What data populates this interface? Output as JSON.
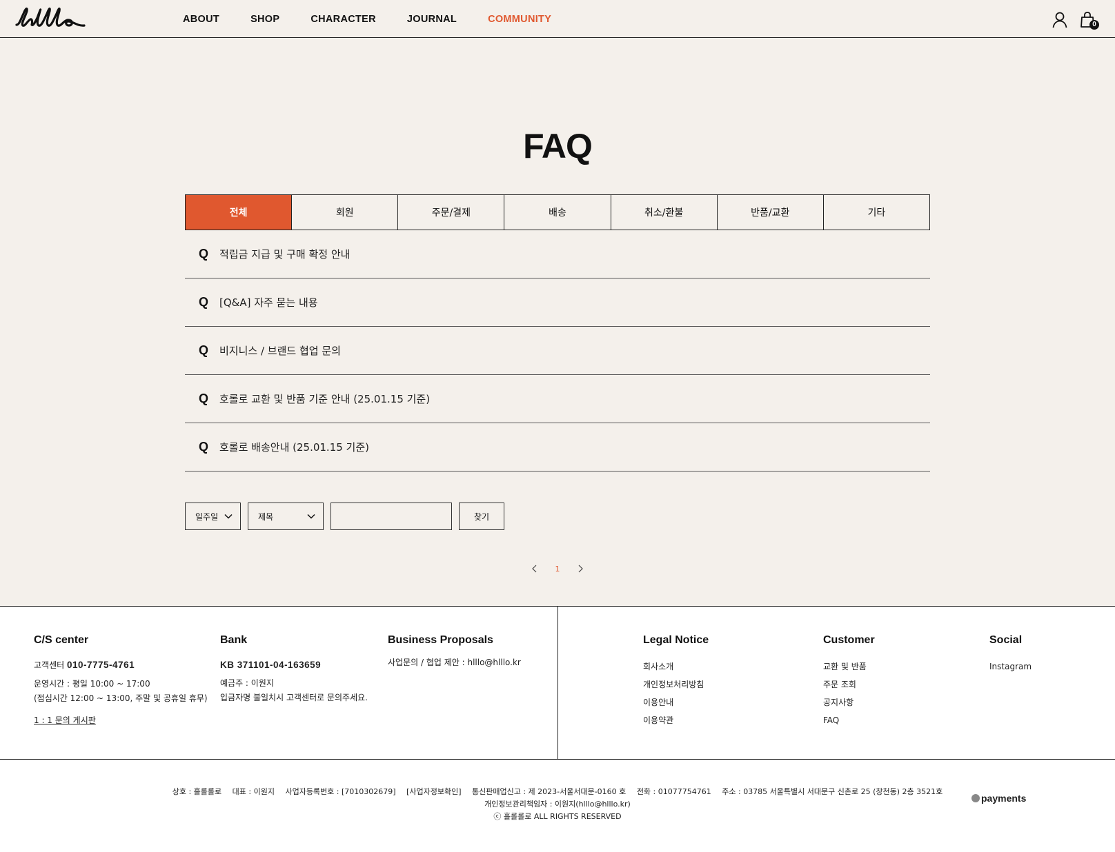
{
  "brand": {
    "logo_text": "hlllo",
    "accent": "#e0582f"
  },
  "nav": {
    "items": [
      {
        "label": "ABOUT"
      },
      {
        "label": "SHOP"
      },
      {
        "label": "CHARACTER"
      },
      {
        "label": "JOURNAL"
      },
      {
        "label": "COMMUNITY",
        "active": true
      }
    ],
    "cart_count": "0"
  },
  "page": {
    "title": "FAQ"
  },
  "tabs": [
    {
      "label": "전체",
      "active": true
    },
    {
      "label": "회원"
    },
    {
      "label": "주문/결제"
    },
    {
      "label": "배송"
    },
    {
      "label": "취소/환불"
    },
    {
      "label": "반품/교환"
    },
    {
      "label": "기타"
    }
  ],
  "faq": [
    {
      "q": "Q",
      "text": "적립금 지급 및 구매 확정 안내"
    },
    {
      "q": "Q",
      "text": "[Q&A] 자주 묻는 내용"
    },
    {
      "q": "Q",
      "text": "비지니스 / 브랜드 협업 문의"
    },
    {
      "q": "Q",
      "text": "호롤로 교환 및 반품 기준 안내 (25.01.15 기준)"
    },
    {
      "q": "Q",
      "text": "호롤로 배송안내 (25.01.15 기준)"
    }
  ],
  "search": {
    "period": "일주일",
    "field": "제목",
    "input_value": "",
    "button": "찾기"
  },
  "pagination": {
    "current": "1"
  },
  "footer": {
    "cs": {
      "title": "C/S center",
      "phone_label": "고객센터",
      "phone": "010-7775-4761",
      "hours": "운영시간 : 평일 10:00 ~ 17:00",
      "lunch": "(점심시간 12:00 ~ 13:00, 주말 및 공휴일 휴무)",
      "board_link": "1 : 1 문의 게시판"
    },
    "bank": {
      "title": "Bank",
      "account": "KB 371101-04-163659",
      "holder": "예금주 : 이원지",
      "note": "입금자명 불일치시 고객센터로 문의주세요."
    },
    "business": {
      "title": "Business Proposals",
      "line": "사업문의 / 협업 제안 : hlllo@hlllo.kr"
    },
    "legal": {
      "title": "Legal Notice",
      "links": [
        "회사소개",
        "개인정보처리방침",
        "이용안내",
        "이용약관"
      ]
    },
    "customer": {
      "title": "Customer",
      "links": [
        "교환 및 반품",
        "주문 조회",
        "공지사항",
        "FAQ"
      ]
    },
    "social": {
      "title": "Social",
      "links": [
        "Instagram"
      ]
    },
    "company": {
      "name": "상호 : 홀롤롤로",
      "ceo": "대표 : 이원지",
      "biz_no": "사업자등록번호 : [7010302679]",
      "biz_check": "[사업자정보확인]",
      "ecommerce": "통신판매업신고 : 제 2023-서울서대문-0160 호",
      "tel": "전화 : 01077754761",
      "address": "주소 : 03785 서울특별시 서대문구 신촌로 25 (창천동) 2층 3521호",
      "privacy_officer": "개인정보관리책임자 : 이원지(hlllo@hlllo.kr)",
      "copyright": "ⓒ 홀롤롤로 ALL RIGHTS RESERVED"
    },
    "payments_logo": "payments"
  }
}
